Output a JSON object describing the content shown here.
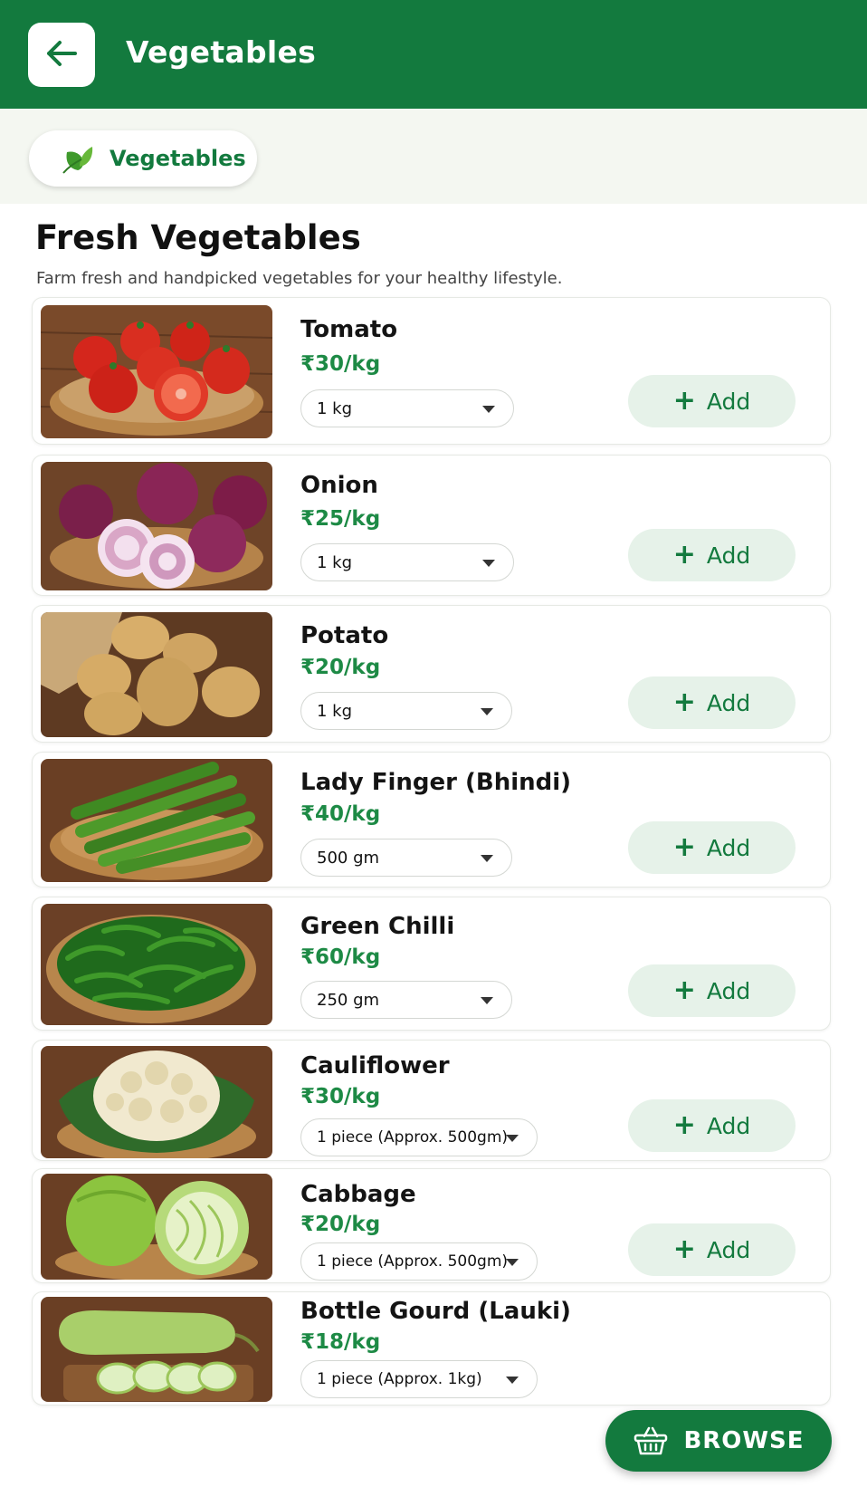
{
  "header": {
    "title": "Vegetables",
    "back_icon": "arrow-left-icon"
  },
  "category_chip": {
    "label": "Vegetables",
    "icon": "leaf-icon"
  },
  "section": {
    "title": "Fresh Vegetables",
    "subtitle": "Farm fresh and handpicked vegetables for your healthy lifestyle."
  },
  "add_label": "Add",
  "products": [
    {
      "name": "Tomato",
      "price": "₹30/kg",
      "quantity": "1 kg",
      "image": "tomato-basket"
    },
    {
      "name": "Onion",
      "price": "₹25/kg",
      "quantity": "1 kg",
      "image": "onion-basket"
    },
    {
      "name": "Potato",
      "price": "₹20/kg",
      "quantity": "1 kg",
      "image": "potato-sack"
    },
    {
      "name": "Lady Finger (Bhindi)",
      "price": "₹40/kg",
      "quantity": "500 gm",
      "image": "okra-basket"
    },
    {
      "name": "Green Chilli",
      "price": "₹60/kg",
      "quantity": "250 gm",
      "image": "chilli-basket"
    },
    {
      "name": "Cauliflower",
      "price": "₹30/kg",
      "quantity": "1 piece (Approx. 500gm)",
      "image": "cauliflower-basket"
    },
    {
      "name": "Cabbage",
      "price": "₹20/kg",
      "quantity": "1 piece (Approx. 500gm)",
      "image": "cabbage-basket"
    },
    {
      "name": "Bottle Gourd (Lauki)",
      "price": "₹18/kg",
      "quantity": "1 piece (Approx. 1kg)",
      "image": "bottle-gourd"
    }
  ],
  "browse": {
    "label": "BROWSE",
    "icon": "basket-icon"
  },
  "colors": {
    "primary": "#137a3e",
    "price": "#1d8a45",
    "add_bg": "#e6f2e9",
    "chip_bg": "#f4f7f1"
  }
}
